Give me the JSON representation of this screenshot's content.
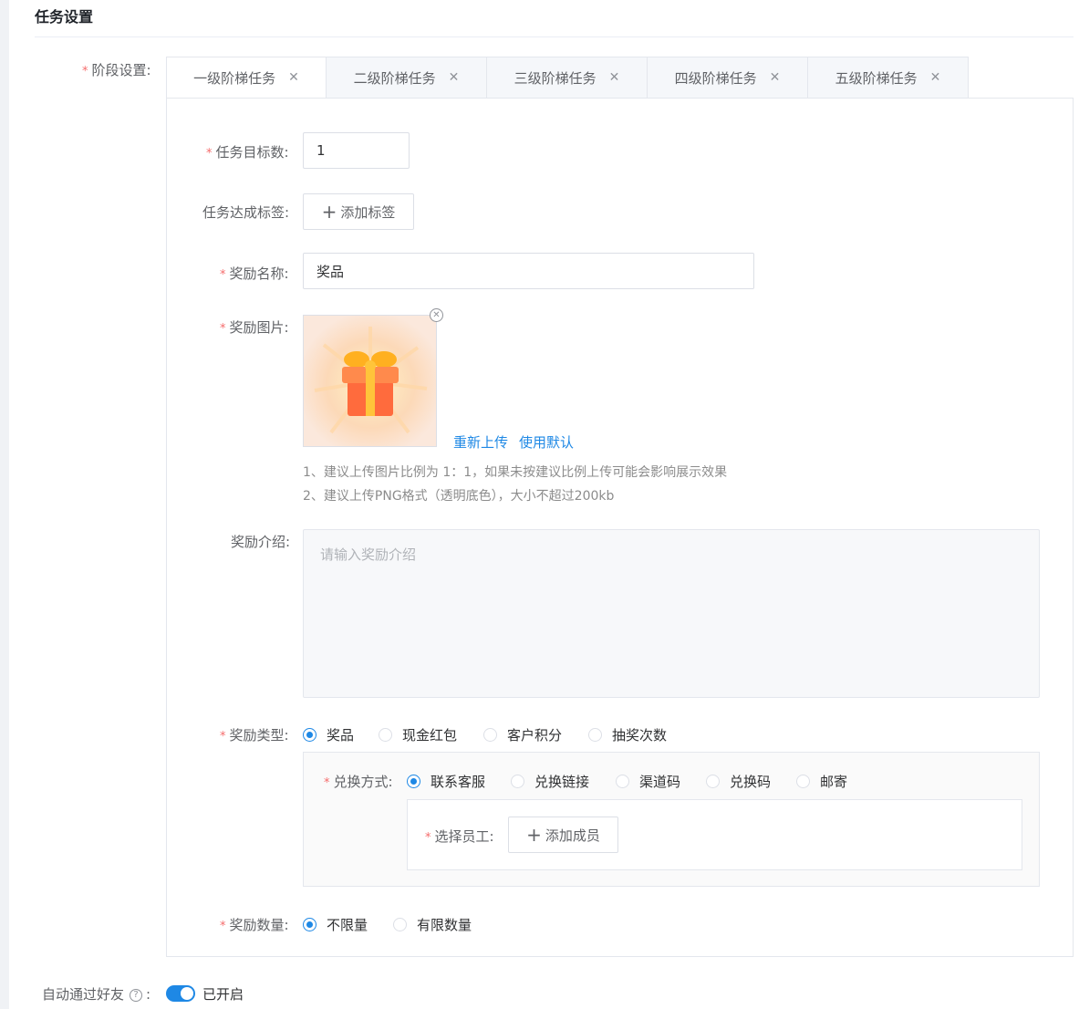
{
  "section": {
    "title": "任务设置"
  },
  "stage": {
    "label": "阶段设置:",
    "tabs": [
      {
        "label": "一级阶梯任务"
      },
      {
        "label": "二级阶梯任务"
      },
      {
        "label": "三级阶梯任务"
      },
      {
        "label": "四级阶梯任务"
      },
      {
        "label": "五级阶梯任务"
      }
    ],
    "active_tab": "一级阶梯任务"
  },
  "form": {
    "target_label": "任务目标数:",
    "target_value": "1",
    "tags_label": "任务达成标签:",
    "add_tag_button": "添加标签",
    "reward_name_label": "奖励名称:",
    "reward_name_value": "奖品",
    "reward_image_label": "奖励图片:",
    "reupload_link": "重新上传",
    "use_default_link": "使用默认",
    "hint_1": "1、建议上传图片比例为 1：1，如果未按建议比例上传可能会影响展示效果",
    "hint_2": "2、建议上传PNG格式（透明底色），大小不超过200kb",
    "reward_intro_label": "奖励介绍:",
    "reward_intro_placeholder": "请输入奖励介绍",
    "reward_type_label": "奖励类型:",
    "reward_types": [
      "奖品",
      "现金红包",
      "客户积分",
      "抽奖次数"
    ],
    "reward_type_selected": "奖品",
    "exchange_label": "兑换方式:",
    "exchange_methods": [
      "联系客服",
      "兑换链接",
      "渠道码",
      "兑换码",
      "邮寄"
    ],
    "exchange_selected": "联系客服",
    "staff_label": "选择员工:",
    "add_member_button": "添加成员",
    "quantity_label": "奖励数量:",
    "quantity_options": [
      "不限量",
      "有限数量"
    ],
    "quantity_selected": "不限量"
  },
  "auto_friend": {
    "label": "自动通过好友",
    "colon": ":",
    "status": "已开启",
    "enabled": true
  },
  "colors": {
    "accent": "#1e88e5",
    "required": "#f56c6c"
  }
}
